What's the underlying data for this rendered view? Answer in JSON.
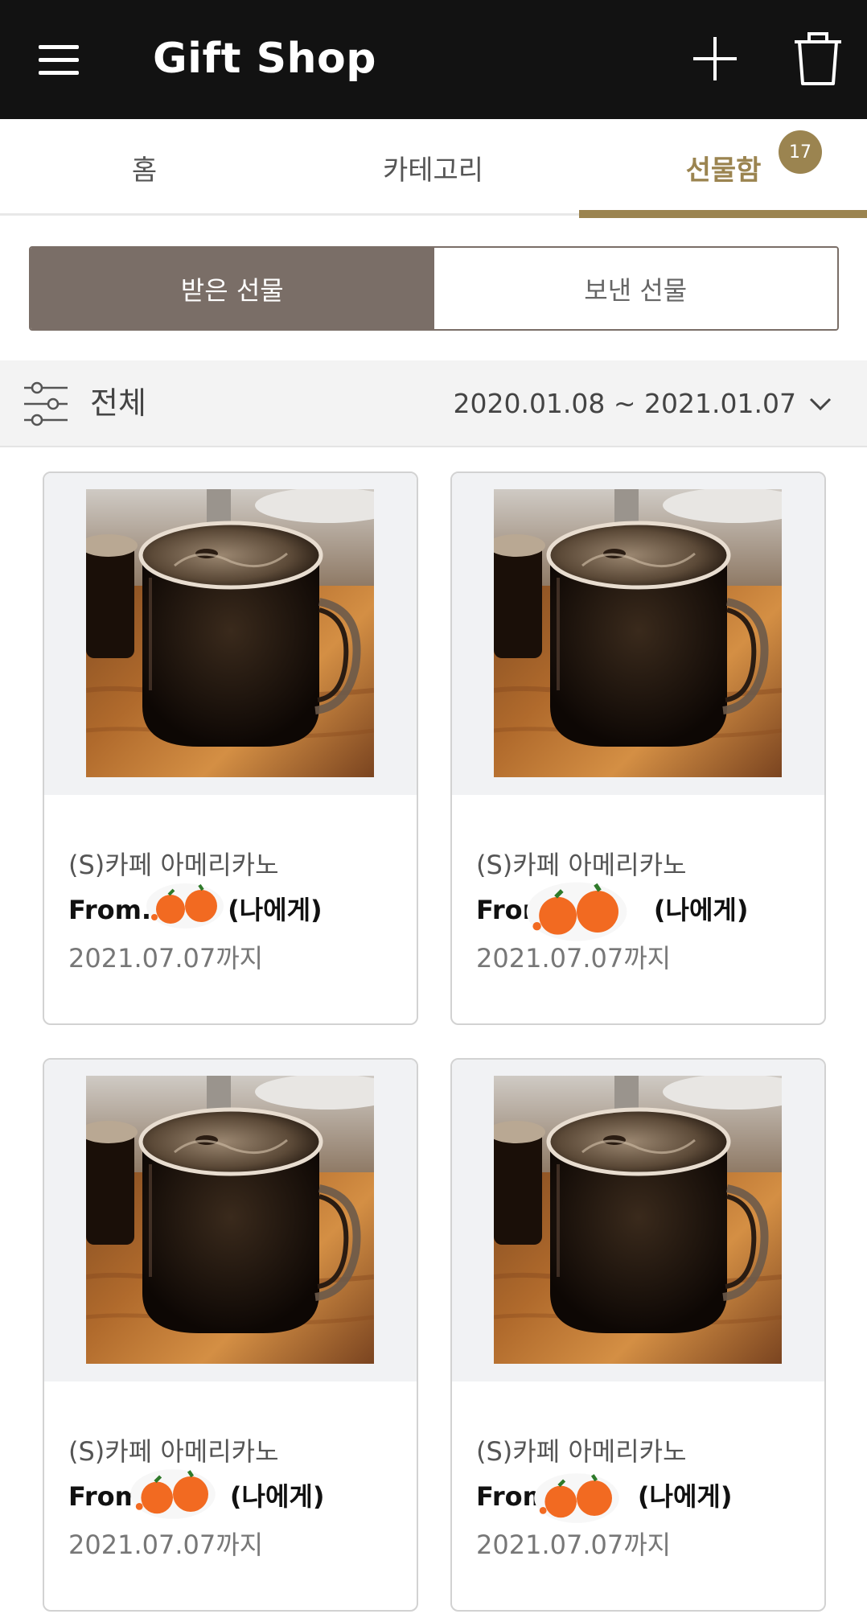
{
  "app": {
    "title": "Gift Shop"
  },
  "tabs": [
    {
      "label": "홈",
      "active": false
    },
    {
      "label": "카테고리",
      "active": false
    },
    {
      "label": "선물함",
      "active": true,
      "badge": "17"
    }
  ],
  "segment": {
    "received_label": "받은 선물",
    "sent_label": "보낸 선물",
    "active": "received"
  },
  "filter": {
    "label": "전체",
    "date_range": "2020.01.08 ~ 2021.01.07"
  },
  "colors": {
    "accent": "#9b8450",
    "header_bg": "#121212",
    "segment_active": "#7a6e67"
  },
  "gifts": [
    {
      "name": "(S)카페 아메리카노",
      "from_prefix": "From.",
      "from_suffix": "(나에게)",
      "expiry": "2021.07.07까지"
    },
    {
      "name": "(S)카페 아메리카노",
      "from_prefix": "From",
      "from_suffix": "(나에게)",
      "expiry": "2021.07.07까지"
    },
    {
      "name": "(S)카페 아메리카노",
      "from_prefix": "From",
      "from_suffix": "(나에게)",
      "expiry": "2021.07.07까지"
    },
    {
      "name": "(S)카페 아메리카노",
      "from_prefix": "From",
      "from_suffix": "(나에게)",
      "expiry": "2021.07.07까지"
    }
  ]
}
